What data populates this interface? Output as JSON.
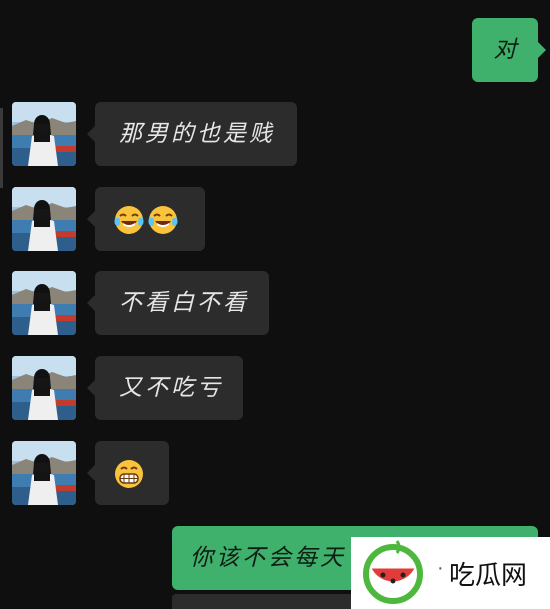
{
  "messages": {
    "m1_out": "对",
    "m2_in": "那男的也是贱",
    "m3_in_emoji": [
      "crying-laughing-face-icon",
      "crying-laughing-face-icon"
    ],
    "m4_in": "不看白不看",
    "m5_in": "又不吃亏",
    "m6_in_emoji": [
      "grimacing-face-icon"
    ],
    "m7_out_partial": "你该不会每天"
  },
  "watermark": {
    "text": "吃瓜网",
    "dot": "·"
  },
  "colors": {
    "background": "#0f0f0f",
    "incoming_bubble": "#2c2c2c",
    "outgoing_bubble": "#3fb16d",
    "watermark_green": "#4db83d",
    "watermark_red": "#e23b3b"
  }
}
